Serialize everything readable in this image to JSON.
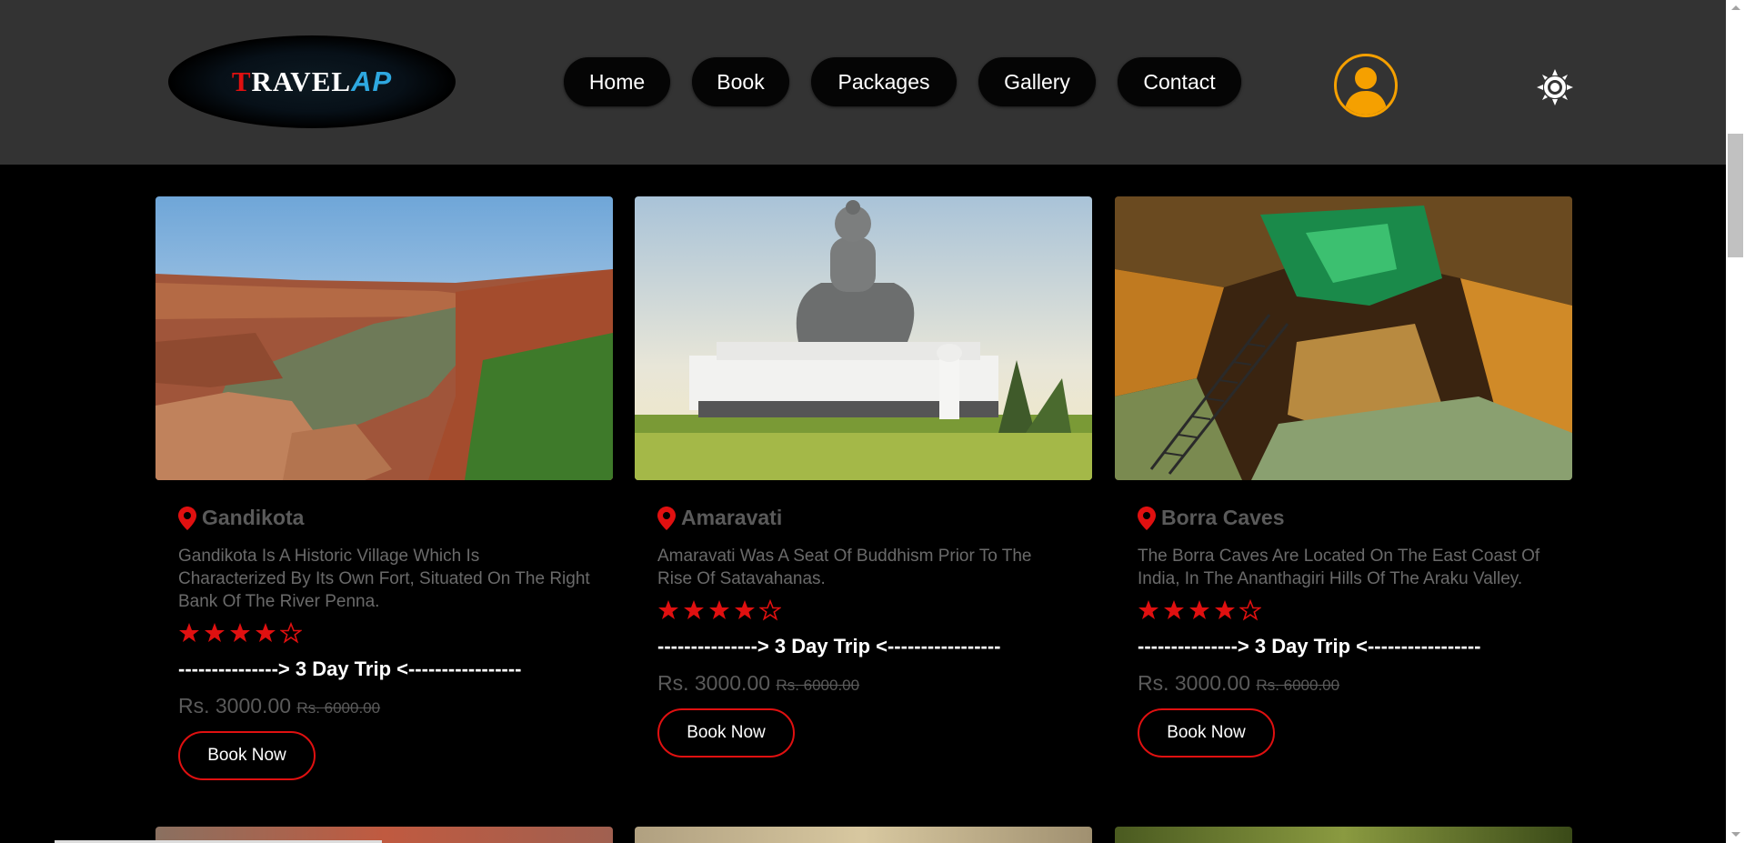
{
  "logo": {
    "t": "T",
    "rest": "RAVEL",
    "ap": "AP"
  },
  "nav": [
    {
      "label": "Home"
    },
    {
      "label": "Book"
    },
    {
      "label": "Packages"
    },
    {
      "label": "Gallery"
    },
    {
      "label": "Contact"
    }
  ],
  "colors": {
    "accent": "#e01010",
    "user_ring": "#f5a000",
    "header_bg": "#333333"
  },
  "cards": [
    {
      "title": "Gandikota",
      "desc": "Gandikota Is A Historic Village Which Is Characterized By Its Own Fort, Situated On The Right Bank Of The River Penna.",
      "rating": 4,
      "trip": "---------------> 3 Day Trip <-----------------",
      "price": "Rs. 3000.00",
      "old_price": "Rs. 6000.00",
      "button": "Book Now"
    },
    {
      "title": "Amaravati",
      "desc": "Amaravati Was A Seat Of Buddhism Prior To The Rise Of Satavahanas.",
      "rating": 4,
      "trip": "---------------> 3 Day Trip <-----------------",
      "price": "Rs. 3000.00",
      "old_price": "Rs. 6000.00",
      "button": "Book Now"
    },
    {
      "title": "Borra Caves",
      "desc": "The Borra Caves Are Located On The East Coast Of India, In The Ananthagiri Hills Of The Araku Valley.",
      "rating": 4,
      "trip": "---------------> 3 Day Trip <-----------------",
      "price": "Rs. 3000.00",
      "old_price": "Rs. 6000.00",
      "button": "Book Now"
    }
  ]
}
